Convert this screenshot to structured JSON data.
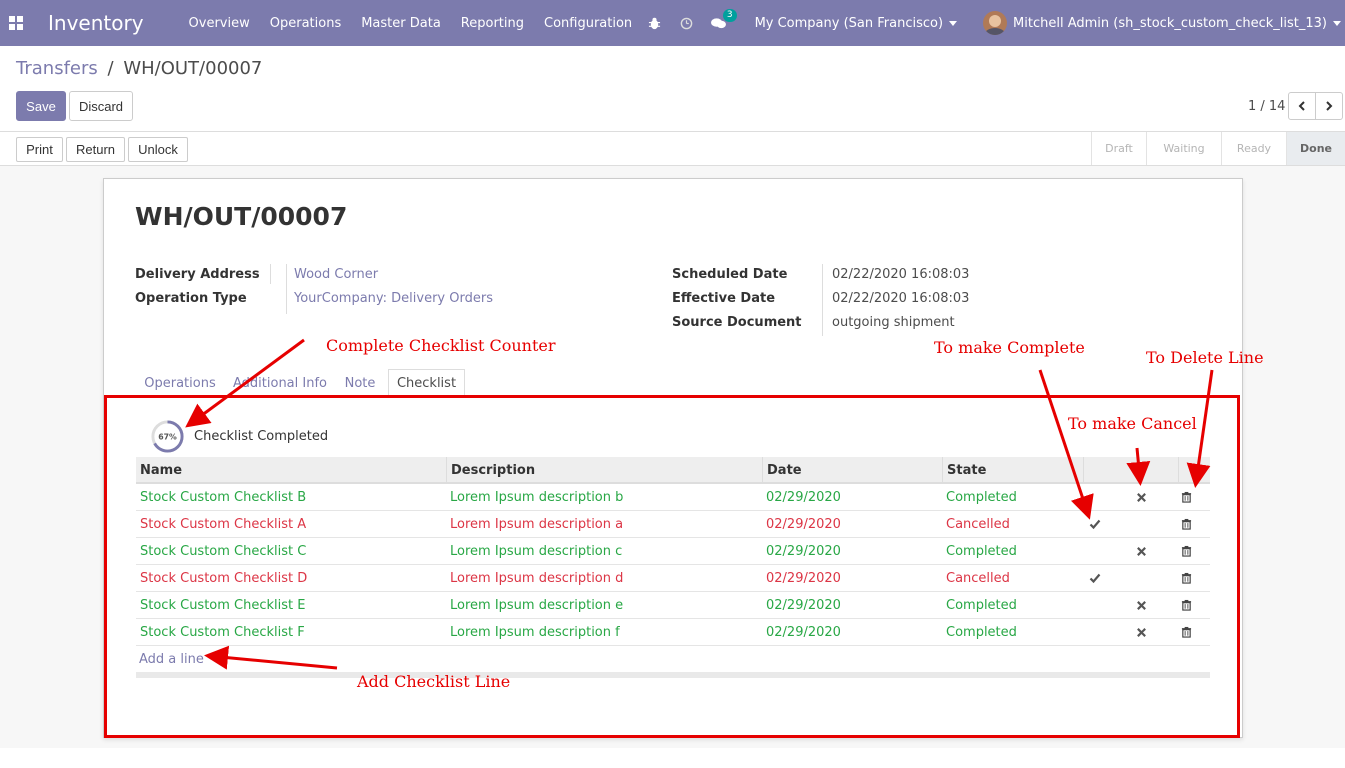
{
  "navbar": {
    "app_name": "Inventory",
    "menu": [
      "Overview",
      "Operations",
      "Master Data",
      "Reporting",
      "Configuration"
    ],
    "messages_count": "3",
    "company": "My Company (San Francisco)",
    "user": "Mitchell Admin (sh_stock_custom_check_list_13)",
    "accent_color": "#7c7bad"
  },
  "breadcrumb": {
    "parent": "Transfers",
    "separator": "/",
    "current": "WH/OUT/00007"
  },
  "actions": {
    "save": "Save",
    "discard": "Discard"
  },
  "pager": {
    "value": "1 / 14"
  },
  "statusbar": {
    "buttons": [
      "Print",
      "Return",
      "Unlock"
    ],
    "stages": [
      "Draft",
      "Waiting",
      "Ready",
      "Done"
    ],
    "active_stage": "Done"
  },
  "form": {
    "title": "WH/OUT/00007",
    "delivery_address_label": "Delivery Address",
    "delivery_address": "Wood Corner",
    "operation_type_label": "Operation Type",
    "operation_type": "YourCompany: Delivery Orders",
    "scheduled_date_label": "Scheduled Date",
    "scheduled_date": "02/22/2020 16:08:03",
    "effective_date_label": "Effective Date",
    "effective_date": "02/22/2020 16:08:03",
    "source_document_label": "Source Document",
    "source_document": "outgoing shipment"
  },
  "tabs": [
    "Operations",
    "Additional Info",
    "Note",
    "Checklist"
  ],
  "active_tab": "Checklist",
  "checklist": {
    "progress_text": "67%",
    "progress_fraction": 0.67,
    "progress_label": "Checklist Completed",
    "columns": [
      "Name",
      "Description",
      "Date",
      "State"
    ],
    "rows": [
      {
        "name": "Stock Custom Checklist B",
        "description": "Lorem Ipsum description b",
        "date": "02/29/2020",
        "state": "Completed"
      },
      {
        "name": "Stock Custom Checklist A",
        "description": "Lorem Ipsum description a",
        "date": "02/29/2020",
        "state": "Cancelled"
      },
      {
        "name": "Stock Custom Checklist C",
        "description": "Lorem Ipsum description c",
        "date": "02/29/2020",
        "state": "Completed"
      },
      {
        "name": "Stock Custom Checklist D",
        "description": "Lorem Ipsum description d",
        "date": "02/29/2020",
        "state": "Cancelled"
      },
      {
        "name": "Stock Custom Checklist E",
        "description": "Lorem Ipsum description e",
        "date": "02/29/2020",
        "state": "Completed"
      },
      {
        "name": "Stock Custom Checklist F",
        "description": "Lorem Ipsum description f",
        "date": "02/29/2020",
        "state": "Completed"
      }
    ],
    "add_line": "Add a line",
    "completed_color": "#28a745",
    "cancelled_color": "#dc3545"
  },
  "annotations": {
    "counter": "Complete Checklist Counter",
    "make_complete": "To make Complete",
    "delete_line": "To Delete Line",
    "make_cancel": "To make Cancel",
    "add_line": "Add Checklist Line",
    "color": "#e60000"
  }
}
